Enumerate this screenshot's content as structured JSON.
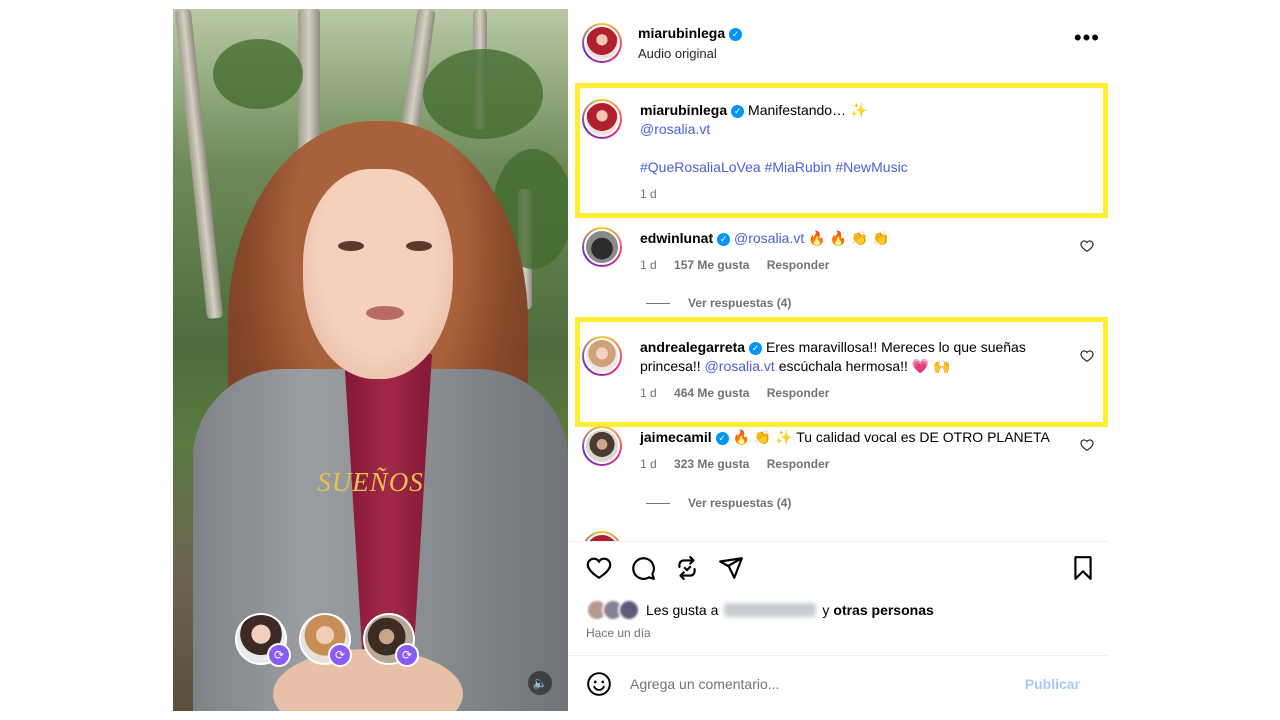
{
  "video": {
    "caption": "SUEÑOS",
    "sound_icon": "speaker-icon",
    "repost_badge_icon": "repost-icon"
  },
  "post": {
    "author": "miarubinlega",
    "subtitle": "Audio original",
    "more_icon": "more-icon"
  },
  "caption_comment": {
    "username": "miarubinlega",
    "text": "Manifestando… ✨",
    "mention": "@rosalia.vt",
    "hashtags": "#QueRosaliaLoVea #MiaRubin #NewMusic",
    "time": "1 d"
  },
  "comments": [
    {
      "username": "edwinlunat",
      "mention": "@rosalia.vt",
      "text_after": " 🔥 🔥 👏 👏",
      "time": "1 d",
      "likes": "157 Me gusta",
      "reply": "Responder",
      "view_replies": "Ver respuestas (4)"
    },
    {
      "username": "andrealegarreta",
      "text_before": " Eres maravillosa!! Mereces lo que sueñas princesa!! ",
      "mention": "@rosalia.vt",
      "text_after": " escúchala hermosa!! 💗 🙌",
      "time": "1 d",
      "likes": "464 Me gusta",
      "reply": "Responder"
    },
    {
      "username": "jaimecamil",
      "text": " 🔥 👏 ✨  Tu calidad vocal es DE OTRO PLANETA",
      "time": "1 d",
      "likes": "323 Me gusta",
      "reply": "Responder",
      "view_replies": "Ver respuestas (4)"
    }
  ],
  "likes_summary": {
    "prefix": "Les gusta a",
    "middle": "y",
    "suffix": "otras personas"
  },
  "post_time": "Hace un día",
  "composer": {
    "placeholder": "Agrega un comentario...",
    "post_label": "Publicar"
  },
  "colors": {
    "highlight": "#ffee33",
    "link": "#4a5fd9",
    "verified": "#0095f6",
    "repost_badge": "#8a5cf5"
  }
}
